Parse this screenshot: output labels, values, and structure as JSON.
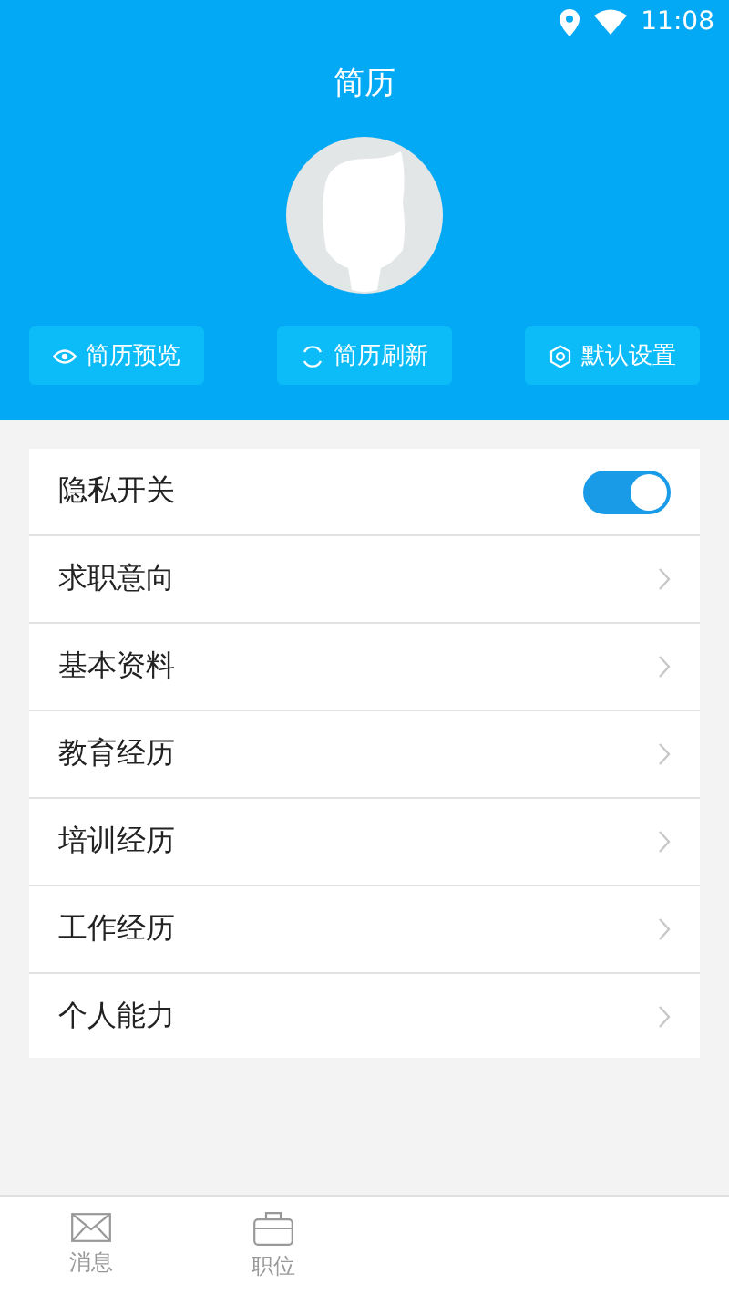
{
  "status_bar": {
    "time": "11:08"
  },
  "header": {
    "title": "简历"
  },
  "actions": [
    {
      "label": "简历预览",
      "kind": "preview"
    },
    {
      "label": "简历刷新",
      "kind": "refresh"
    },
    {
      "label": "默认设置",
      "kind": "settings"
    }
  ],
  "rows": [
    {
      "label": "隐私开关",
      "kind": "toggle",
      "on": true
    },
    {
      "label": "求职意向",
      "kind": "link"
    },
    {
      "label": "基本资料",
      "kind": "link"
    },
    {
      "label": "教育经历",
      "kind": "link"
    },
    {
      "label": "培训经历",
      "kind": "link"
    },
    {
      "label": "工作经历",
      "kind": "link"
    },
    {
      "label": "个人能力",
      "kind": "link"
    }
  ],
  "bottom_nav": [
    {
      "label": "消息",
      "kind": "messages",
      "selected": false
    },
    {
      "label": "职位",
      "kind": "jobs",
      "selected": false
    }
  ]
}
